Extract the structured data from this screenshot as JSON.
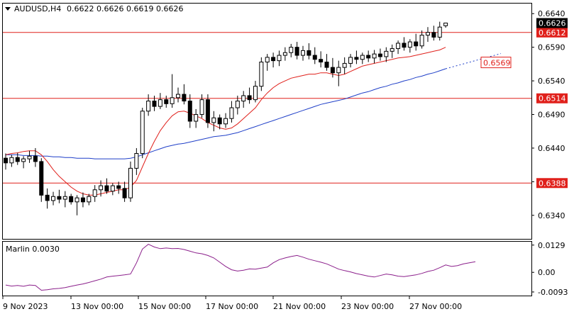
{
  "header": {
    "symbol": "AUDUSD,H4",
    "ohlc": "0.6622 0.6626 0.6619 0.6626"
  },
  "indicator": {
    "label": "Marlin 0.0030"
  },
  "colors": {
    "background": "#ffffff",
    "frame": "#000000",
    "level_line": "#e0201b",
    "ma_fast": "#e0201b",
    "ma_slow": "#1f3fc8",
    "marlin_line": "#8b1f8b",
    "candle": "#000000"
  },
  "chart_data": {
    "type": "candlestick",
    "price_axis_ticks": [
      "0.6640",
      "0.6590",
      "0.6540",
      "0.6490",
      "0.6440",
      "0.6390",
      "0.6340"
    ],
    "price_ylim": [
      0.6305,
      0.6655
    ],
    "time_axis_labels": [
      "9 Nov 2023",
      "13 Nov 00:00",
      "15 Nov 00:00",
      "17 Nov 00:00",
      "21 Nov 00:00",
      "23 Nov 00:00",
      "27 Nov 00:00"
    ],
    "current_price": "0.6626",
    "levels": [
      {
        "value": 0.6612,
        "label": "0.6612"
      },
      {
        "value": 0.6514,
        "label": "0.6514"
      },
      {
        "value": 0.6388,
        "label": "0.6388"
      }
    ],
    "ma_target": {
      "value": 0.6569,
      "label": "0.6569"
    },
    "candles": [
      [
        0.6425,
        0.6432,
        0.6408,
        0.6418
      ],
      [
        0.6418,
        0.643,
        0.6412,
        0.6426
      ],
      [
        0.6426,
        0.6433,
        0.6415,
        0.642
      ],
      [
        0.642,
        0.6428,
        0.641,
        0.6424
      ],
      [
        0.6424,
        0.6436,
        0.6418,
        0.6428
      ],
      [
        0.6428,
        0.644,
        0.6412,
        0.642
      ],
      [
        0.642,
        0.6425,
        0.636,
        0.637
      ],
      [
        0.637,
        0.638,
        0.635,
        0.6362
      ],
      [
        0.6362,
        0.6375,
        0.6355,
        0.6368
      ],
      [
        0.6368,
        0.6378,
        0.6358,
        0.6364
      ],
      [
        0.6364,
        0.6376,
        0.6352,
        0.6368
      ],
      [
        0.6368,
        0.6372,
        0.6356,
        0.636
      ],
      [
        0.636,
        0.637,
        0.634,
        0.6366
      ],
      [
        0.6366,
        0.6374,
        0.6352,
        0.636
      ],
      [
        0.636,
        0.6372,
        0.6355,
        0.6368
      ],
      [
        0.6368,
        0.6385,
        0.636,
        0.6378
      ],
      [
        0.6378,
        0.6392,
        0.6368,
        0.6384
      ],
      [
        0.6384,
        0.6395,
        0.6372,
        0.6376
      ],
      [
        0.6376,
        0.6388,
        0.637,
        0.6384
      ],
      [
        0.6384,
        0.639,
        0.6372,
        0.638
      ],
      [
        0.638,
        0.639,
        0.636,
        0.6366
      ],
      [
        0.6366,
        0.642,
        0.636,
        0.641
      ],
      [
        0.641,
        0.644,
        0.64,
        0.6432
      ],
      [
        0.6432,
        0.65,
        0.6425,
        0.6495
      ],
      [
        0.6495,
        0.652,
        0.6488,
        0.651
      ],
      [
        0.651,
        0.6518,
        0.6495,
        0.6502
      ],
      [
        0.6502,
        0.6522,
        0.6498,
        0.6512
      ],
      [
        0.6512,
        0.6518,
        0.65,
        0.6506
      ],
      [
        0.6506,
        0.655,
        0.65,
        0.6515
      ],
      [
        0.6515,
        0.653,
        0.6508,
        0.652
      ],
      [
        0.652,
        0.6535,
        0.6505,
        0.651
      ],
      [
        0.651,
        0.652,
        0.647,
        0.648
      ],
      [
        0.648,
        0.6498,
        0.647,
        0.649
      ],
      [
        0.649,
        0.652,
        0.6485,
        0.6512
      ],
      [
        0.6512,
        0.652,
        0.647,
        0.6478
      ],
      [
        0.6478,
        0.6495,
        0.6465,
        0.6485
      ],
      [
        0.6485,
        0.649,
        0.6468,
        0.6476
      ],
      [
        0.6476,
        0.6492,
        0.647,
        0.6484
      ],
      [
        0.6484,
        0.651,
        0.6478,
        0.65
      ],
      [
        0.65,
        0.6518,
        0.649,
        0.651
      ],
      [
        0.651,
        0.6525,
        0.65,
        0.6518
      ],
      [
        0.6518,
        0.653,
        0.6506,
        0.6512
      ],
      [
        0.6512,
        0.654,
        0.6508,
        0.6532
      ],
      [
        0.6532,
        0.6575,
        0.6525,
        0.6568
      ],
      [
        0.6568,
        0.658,
        0.6555,
        0.6575
      ],
      [
        0.6575,
        0.6582,
        0.656,
        0.657
      ],
      [
        0.657,
        0.6585,
        0.6562,
        0.6578
      ],
      [
        0.6578,
        0.659,
        0.657,
        0.6582
      ],
      [
        0.6582,
        0.6595,
        0.6575,
        0.659
      ],
      [
        0.659,
        0.6598,
        0.6572,
        0.6578
      ],
      [
        0.6578,
        0.6592,
        0.657,
        0.6585
      ],
      [
        0.6585,
        0.6596,
        0.6572,
        0.6578
      ],
      [
        0.6578,
        0.659,
        0.6565,
        0.6572
      ],
      [
        0.6572,
        0.6584,
        0.656,
        0.6568
      ],
      [
        0.6568,
        0.658,
        0.6555,
        0.656
      ],
      [
        0.656,
        0.6574,
        0.6545,
        0.6552
      ],
      [
        0.6552,
        0.657,
        0.6532,
        0.656
      ],
      [
        0.656,
        0.6575,
        0.655,
        0.6566
      ],
      [
        0.6566,
        0.658,
        0.656,
        0.6575
      ],
      [
        0.6575,
        0.6585,
        0.6565,
        0.6572
      ],
      [
        0.6572,
        0.6582,
        0.6565,
        0.6578
      ],
      [
        0.6578,
        0.6585,
        0.6568,
        0.6574
      ],
      [
        0.6574,
        0.6586,
        0.6566,
        0.658
      ],
      [
        0.658,
        0.6588,
        0.657,
        0.6576
      ],
      [
        0.6576,
        0.659,
        0.6568,
        0.6584
      ],
      [
        0.6584,
        0.6594,
        0.6574,
        0.6588
      ],
      [
        0.6588,
        0.66,
        0.658,
        0.6596
      ],
      [
        0.6596,
        0.6605,
        0.6585,
        0.659
      ],
      [
        0.659,
        0.6602,
        0.6582,
        0.6598
      ],
      [
        0.6598,
        0.661,
        0.6585,
        0.6592
      ],
      [
        0.6592,
        0.6615,
        0.6588,
        0.6608
      ],
      [
        0.6608,
        0.662,
        0.6598,
        0.6612
      ],
      [
        0.6612,
        0.6622,
        0.66,
        0.6605
      ],
      [
        0.6605,
        0.6628,
        0.66,
        0.662
      ],
      [
        0.6622,
        0.6626,
        0.6619,
        0.6626
      ]
    ],
    "ma_fast_series": [
      0.643,
      0.6432,
      0.6433,
      0.6435,
      0.6436,
      0.6436,
      0.643,
      0.642,
      0.6408,
      0.6398,
      0.639,
      0.6382,
      0.6376,
      0.6372,
      0.637,
      0.637,
      0.6372,
      0.6374,
      0.6376,
      0.6378,
      0.6378,
      0.6382,
      0.6392,
      0.6412,
      0.6432,
      0.645,
      0.6466,
      0.6478,
      0.6488,
      0.6494,
      0.6495,
      0.6492,
      0.6488,
      0.6484,
      0.6478,
      0.6474,
      0.647,
      0.6468,
      0.647,
      0.6476,
      0.6484,
      0.6492,
      0.65,
      0.6512,
      0.6522,
      0.653,
      0.6536,
      0.654,
      0.6544,
      0.6546,
      0.6548,
      0.655,
      0.655,
      0.6552,
      0.6552,
      0.655,
      0.6548,
      0.655,
      0.6554,
      0.6558,
      0.6562,
      0.6564,
      0.6566,
      0.6568,
      0.657,
      0.6572,
      0.6574,
      0.6575,
      0.6576,
      0.6578,
      0.658,
      0.6582,
      0.6584,
      0.6586,
      0.659
    ],
    "ma_slow_series": [
      0.643,
      0.643,
      0.643,
      0.6429,
      0.6429,
      0.6429,
      0.6428,
      0.6428,
      0.6427,
      0.6427,
      0.6426,
      0.6426,
      0.6425,
      0.6425,
      0.6425,
      0.6424,
      0.6424,
      0.6424,
      0.6424,
      0.6424,
      0.6424,
      0.6425,
      0.6427,
      0.643,
      0.6433,
      0.6436,
      0.6439,
      0.6442,
      0.6444,
      0.6446,
      0.6447,
      0.6449,
      0.6451,
      0.6453,
      0.6455,
      0.6457,
      0.6458,
      0.6459,
      0.6461,
      0.6463,
      0.6466,
      0.6469,
      0.6472,
      0.6475,
      0.6478,
      0.6481,
      0.6484,
      0.6487,
      0.649,
      0.6493,
      0.6496,
      0.6499,
      0.6502,
      0.6505,
      0.6507,
      0.6509,
      0.6511,
      0.6513,
      0.6516,
      0.6519,
      0.6522,
      0.6524,
      0.6527,
      0.653,
      0.6532,
      0.6535,
      0.6537,
      0.654,
      0.6542,
      0.6545,
      0.6547,
      0.655,
      0.6552,
      0.6555,
      0.6558
    ],
    "marlin_axis_ticks": [
      "0.0129",
      "0.00",
      "-0.0093"
    ],
    "marlin_ylim": [
      -0.011,
      0.0145
    ],
    "marlin_series": [
      -0.006,
      -0.0065,
      -0.0062,
      -0.0066,
      -0.006,
      -0.0062,
      -0.0085,
      -0.0082,
      -0.0078,
      -0.0076,
      -0.0072,
      -0.0066,
      -0.006,
      -0.0055,
      -0.0048,
      -0.004,
      -0.0032,
      -0.0022,
      -0.0018,
      -0.0015,
      -0.0012,
      -0.0008,
      0.0045,
      0.011,
      0.0133,
      0.012,
      0.0112,
      0.0115,
      0.0112,
      0.0113,
      0.0108,
      0.01,
      0.0092,
      0.0088,
      0.008,
      0.0068,
      0.0048,
      0.0028,
      0.0012,
      0.0006,
      0.001,
      0.0016,
      0.0015,
      0.002,
      0.0025,
      0.0045,
      0.006,
      0.0068,
      0.0075,
      0.008,
      0.0072,
      0.0062,
      0.0055,
      0.0048,
      0.004,
      0.0028,
      0.0015,
      0.0008,
      0.0002,
      -0.0006,
      -0.0012,
      -0.0018,
      -0.0022,
      -0.0015,
      -0.0008,
      -0.0012,
      -0.0018,
      -0.002,
      -0.0016,
      -0.0012,
      -0.0005,
      0.0004,
      0.001,
      0.0022,
      0.0035,
      0.0028,
      0.0032,
      0.004,
      0.0045,
      0.005
    ]
  }
}
